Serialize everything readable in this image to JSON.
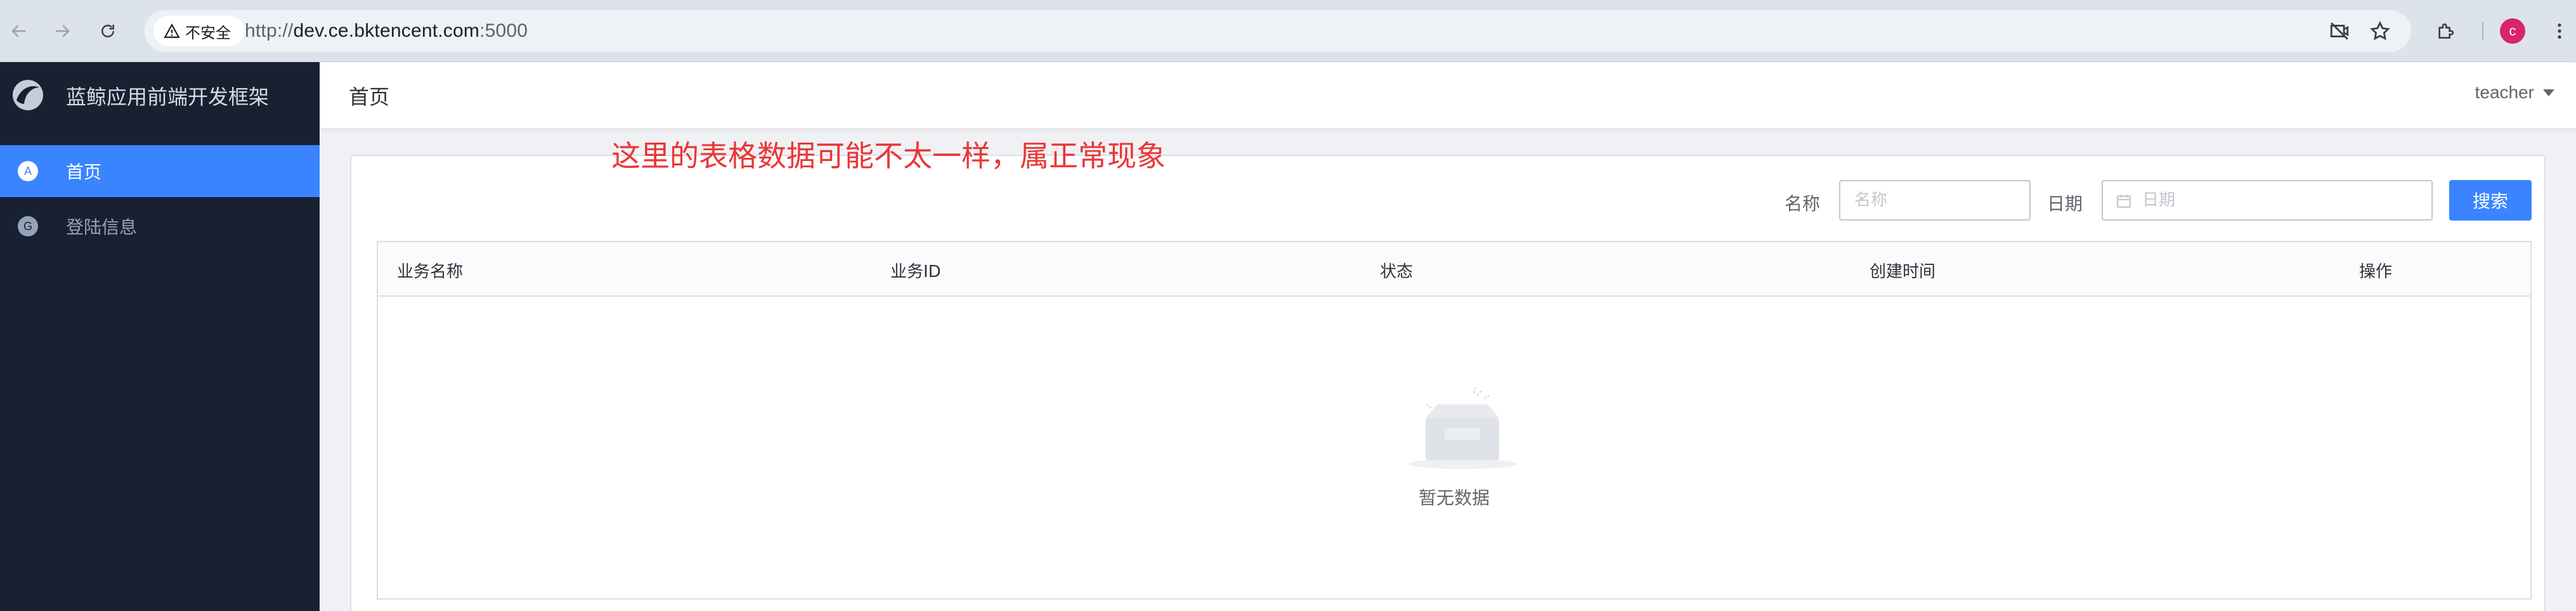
{
  "browser": {
    "back_icon": "arrow-left-icon",
    "forward_icon": "arrow-right-icon",
    "reload_icon": "reload-icon",
    "security_label": "不安全",
    "url_scheme": "http://",
    "url_host": "dev.ce.bktencent.com",
    "url_port": ":5000",
    "profile_initial": "c"
  },
  "sidebar": {
    "brand_title": "蓝鲸应用前端开发框架",
    "items": [
      {
        "badge": "A",
        "label": "首页",
        "active": true
      },
      {
        "badge": "G",
        "label": "登陆信息",
        "active": false
      }
    ]
  },
  "header": {
    "page_title": "首页",
    "username": "teacher"
  },
  "notice": "这里的表格数据可能不太一样，属正常现象",
  "search_form": {
    "name_label": "名称",
    "name_placeholder": "名称",
    "date_label": "日期",
    "date_placeholder": "日期",
    "search_button": "搜索"
  },
  "table": {
    "columns": [
      "业务名称",
      "业务ID",
      "状态",
      "创建时间",
      "操作"
    ],
    "rows": [],
    "empty_text": "暂无数据"
  },
  "colors": {
    "primary": "#3a84ff",
    "sidebar_bg": "#182132",
    "notice": "#ea3636"
  }
}
